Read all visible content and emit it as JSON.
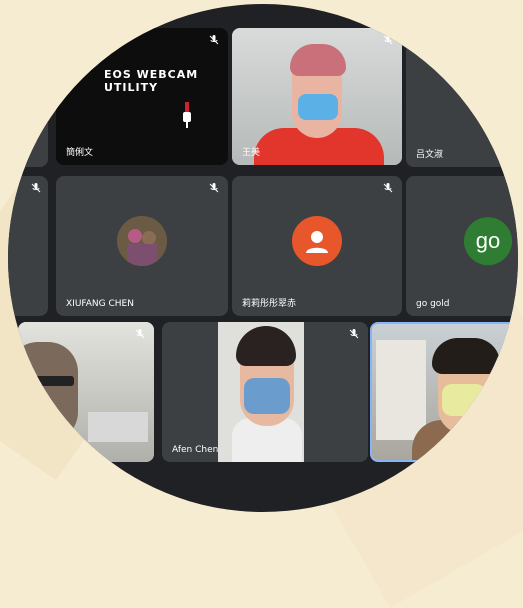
{
  "call": {
    "tiles": [
      {
        "name": "",
        "label": "mute-tile-left-top"
      },
      {
        "name": "簡俐文",
        "overlay_title": "EOS WEBCAM UTILITY"
      },
      {
        "name": "王美"
      },
      {
        "name": "吕文淑"
      },
      {
        "name": ""
      },
      {
        "name": "XIUFANG CHEN"
      },
      {
        "name": "莉莉彤彤翠赤"
      },
      {
        "name": "go gold",
        "avatar_text": "go"
      },
      {
        "name": ""
      },
      {
        "name": "Afen Chen"
      },
      {
        "name": ""
      }
    ]
  },
  "colors": {
    "tile_bg": "#3c4043",
    "call_bg": "#202124",
    "avatar_orange": "#e8572b",
    "avatar_green": "#2f7d32",
    "active_border": "#8ab4f8"
  },
  "icons": [
    "mic-off-icon",
    "webcam-icon",
    "person-icon"
  ]
}
